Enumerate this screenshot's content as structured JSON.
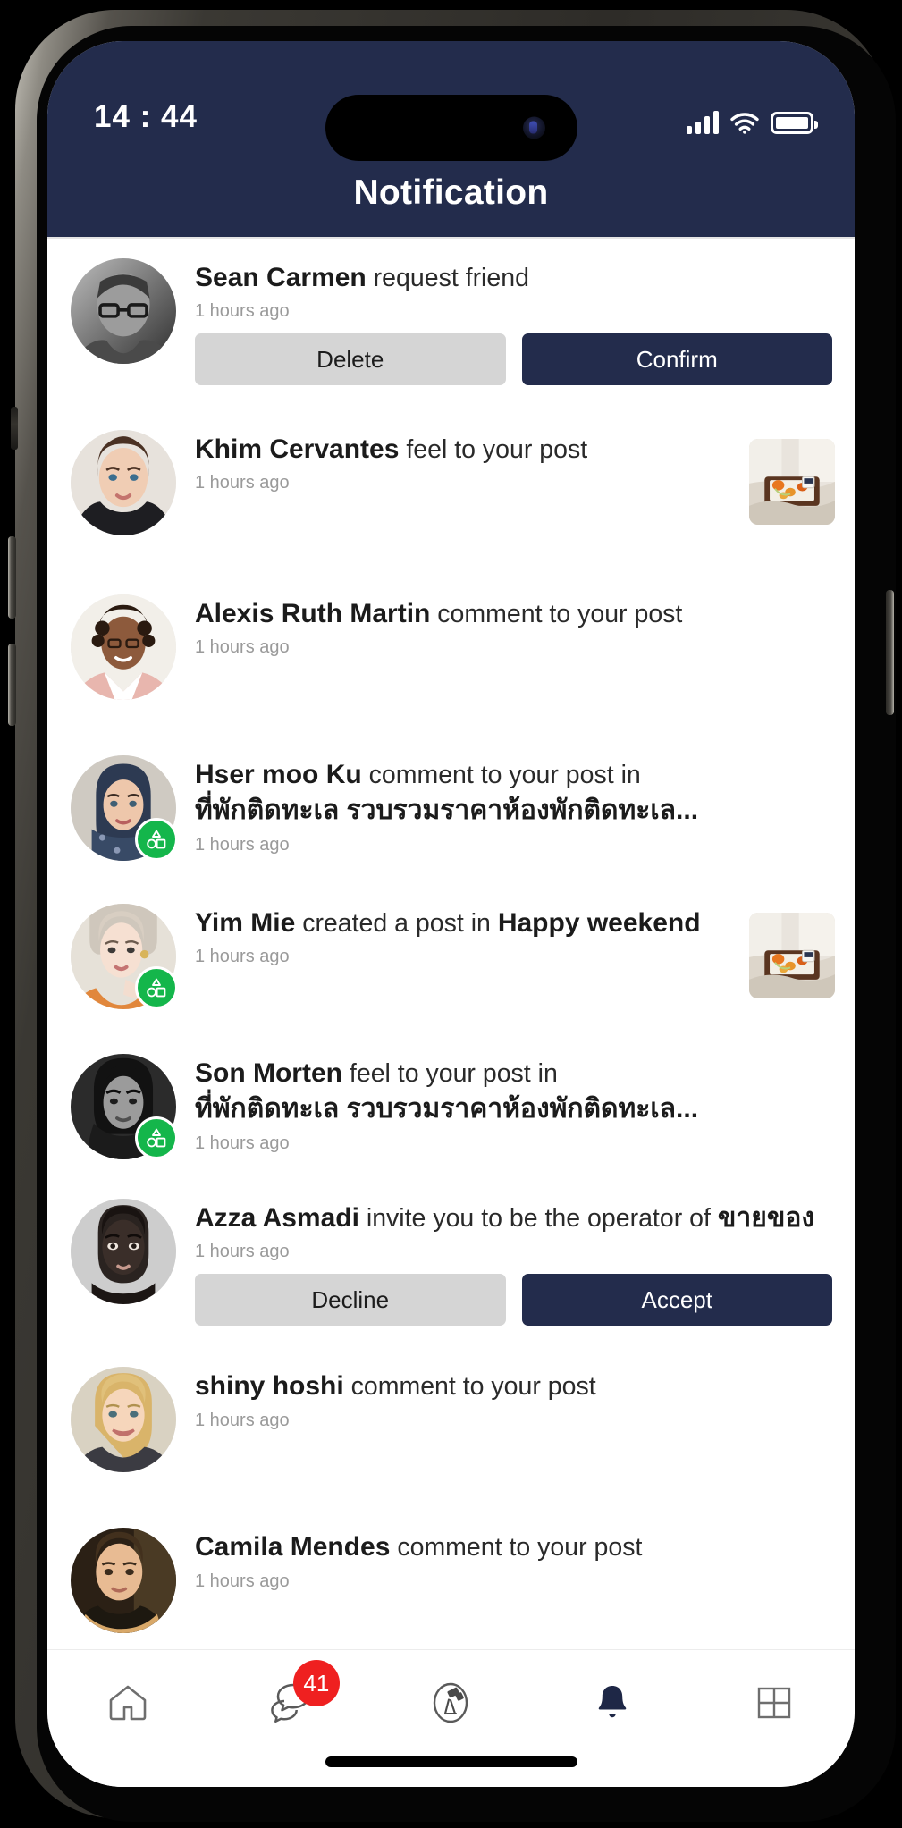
{
  "status_bar": {
    "time": "14 : 44",
    "signal_icon": "cellular-signal-icon",
    "wifi_icon": "wifi-icon",
    "battery_icon": "battery-icon"
  },
  "header": {
    "title": "Notification",
    "background_color": "#232c4c"
  },
  "colors": {
    "primary": "#232c4c",
    "secondary_button": "#d5d5d5",
    "badge_red": "#ef2020",
    "group_green": "#14b64b",
    "timestamp_gray": "#9a9a9a"
  },
  "notifications": [
    {
      "name": "Sean Carmen",
      "action": "request friend",
      "group": "",
      "thai": "",
      "time": "1 hours ago",
      "has_group_badge": false,
      "has_thumbnail": false,
      "buttons": {
        "secondary": "Delete",
        "primary": "Confirm"
      }
    },
    {
      "name": "Khim Cervantes",
      "action": "feel to your post",
      "group": "",
      "thai": "",
      "time": "1 hours ago",
      "has_group_badge": false,
      "has_thumbnail": true,
      "buttons": null
    },
    {
      "name": "Alexis Ruth Martin",
      "action": "comment to your post",
      "group": "",
      "thai": "",
      "time": "1 hours ago",
      "has_group_badge": false,
      "has_thumbnail": false,
      "buttons": null
    },
    {
      "name": "Hser moo Ku",
      "action": "comment to your post in",
      "group": "",
      "thai": "ที่พักติดทะเล รวบรวมราคาห้องพักติดทะเล...",
      "time": "1 hours ago",
      "has_group_badge": true,
      "has_thumbnail": false,
      "buttons": null
    },
    {
      "name": "Yim Mie",
      "action": "created a post in",
      "group": "Happy weekend",
      "thai": "",
      "time": "1 hours ago",
      "has_group_badge": true,
      "has_thumbnail": true,
      "buttons": null
    },
    {
      "name": "Son Morten",
      "action": "feel to your post in",
      "group": "",
      "thai": "ที่พักติดทะเล รวบรวมราคาห้องพักติดทะเล...",
      "time": "1 hours ago",
      "has_group_badge": true,
      "has_thumbnail": false,
      "buttons": null
    },
    {
      "name": "Azza Asmadi",
      "action": "invite you to be the operator of",
      "group": "",
      "thai": "ขายของ",
      "thai_inline": true,
      "time": "1 hours ago",
      "has_group_badge": false,
      "has_thumbnail": false,
      "buttons": {
        "secondary": "Decline",
        "primary": "Accept"
      }
    },
    {
      "name": "shiny hoshi",
      "action": "comment to your post",
      "group": "",
      "thai": "",
      "time": "1 hours ago",
      "has_group_badge": false,
      "has_thumbnail": false,
      "buttons": null
    },
    {
      "name": "Camila Mendes",
      "action": "comment to your post",
      "group": "",
      "thai": "",
      "time": "1 hours ago",
      "has_group_badge": false,
      "has_thumbnail": false,
      "buttons": null
    }
  ],
  "bottom_nav": {
    "items": [
      {
        "icon": "home-icon",
        "active": false,
        "badge": ""
      },
      {
        "icon": "chat-bubbles-icon",
        "active": false,
        "badge": "41"
      },
      {
        "icon": "telescope-discover-icon",
        "active": false,
        "badge": ""
      },
      {
        "icon": "bell-icon",
        "active": true,
        "badge": ""
      },
      {
        "icon": "grid-menu-icon",
        "active": false,
        "badge": ""
      }
    ]
  }
}
